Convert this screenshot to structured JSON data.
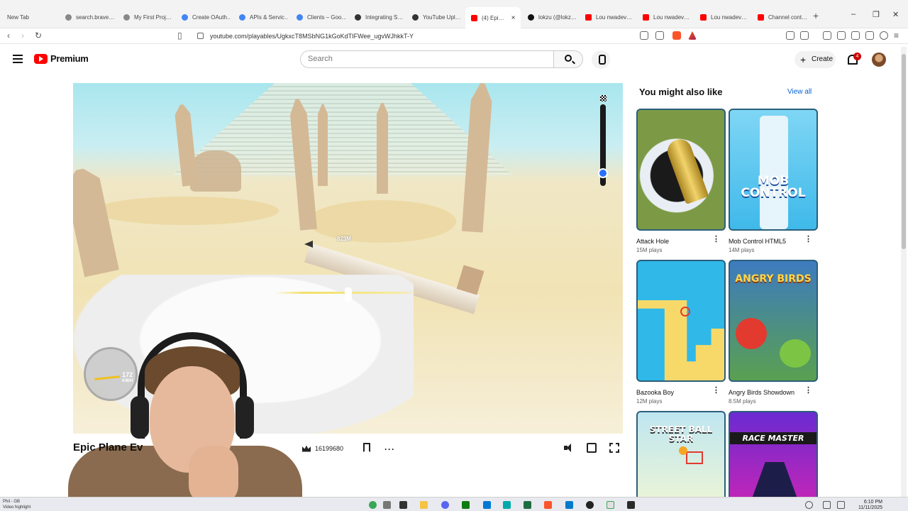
{
  "browser": {
    "tabs": [
      {
        "label": "New Tab",
        "color": "#888888"
      },
      {
        "label": "search.brave…",
        "color": "#888888"
      },
      {
        "label": "My First Proj…",
        "color": "#888888"
      },
      {
        "label": "Create OAuth…",
        "color": "#4285f4"
      },
      {
        "label": "APIs & Servic…",
        "color": "#4285f4"
      },
      {
        "label": "Clients – Goo…",
        "color": "#4285f4"
      },
      {
        "label": "Integrating S…",
        "color": "#333333"
      },
      {
        "label": "YouTube Upl…",
        "color": "#333333"
      },
      {
        "label": "(4) Epi…",
        "color": "#ff0000",
        "active": true
      },
      {
        "label": "lokzu (@lokz…",
        "color": "#111111"
      },
      {
        "label": "Lou nwadev…",
        "color": "#ff0000"
      },
      {
        "label": "Lou nwadev…",
        "color": "#ff0000"
      },
      {
        "label": "Lou nwadev…",
        "color": "#ff0000"
      },
      {
        "label": "Channel cont…",
        "color": "#ff0000"
      }
    ],
    "url": "youtube.com/playables/UgkxcT8MSbNG1kGoKdTIFWee_ugvWJhkkT-Y"
  },
  "header": {
    "logo_text": "Premium",
    "search_placeholder": "Search",
    "create_label": "Create",
    "notification_count": "4"
  },
  "game": {
    "title": "Epic Plane Ev",
    "distance_label": "823M",
    "speed_value": "172",
    "speed_unit": "KM/H",
    "score": "16199680",
    "progress_fraction": 0.84
  },
  "sidebar": {
    "title": "You might also like",
    "view_all": "View all",
    "games": [
      {
        "name": "Attack Hole",
        "plays": "15M plays",
        "bg": "#cfe4f2",
        "accent": "#6d8b3a"
      },
      {
        "name": "Mob Control HTML5",
        "plays": "14M plays",
        "bg": "#55c8f0",
        "accent": "#e8333c",
        "logo": "MOB CONTROL"
      },
      {
        "name": "Bazooka Boy",
        "plays": "12M plays",
        "bg": "#2fb8e8",
        "accent": "#f7d96a"
      },
      {
        "name": "Angry Birds Showdown",
        "plays": "8.5M plays",
        "bg": "#3d7bbf",
        "accent": "#e23a2f",
        "logo": "ANGRY BIRDS"
      },
      {
        "name": "",
        "plays": "",
        "bg": "#bfe6f0",
        "accent": "#f6a623",
        "logo": "STREET BALL STAR"
      },
      {
        "name": "",
        "plays": "",
        "bg": "#6a2ad1",
        "accent": "#ff2bb0",
        "logo": "RACE MASTER"
      }
    ]
  },
  "taskbar": {
    "left_text": "Phil - GB",
    "left_sub": "Video highlight",
    "time": "6:10 PM",
    "date": "11/11/2025"
  }
}
